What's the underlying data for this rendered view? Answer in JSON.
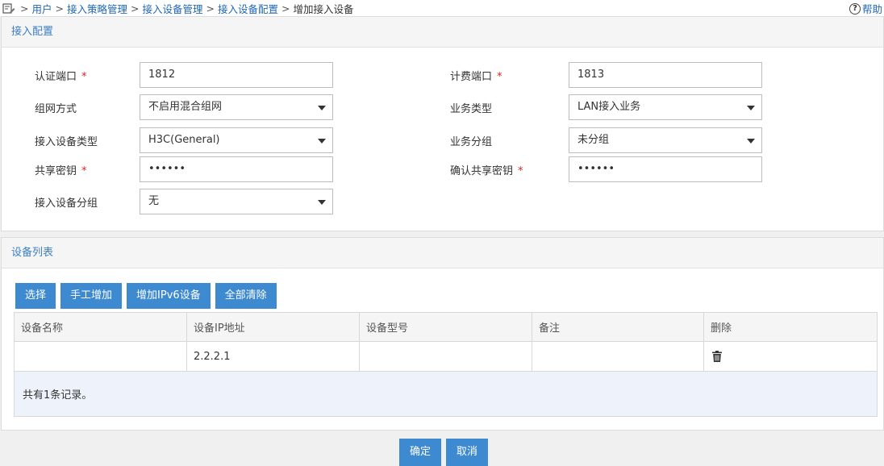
{
  "breadcrumb": {
    "items": [
      "用户",
      "接入策略管理",
      "接入设备管理",
      "接入设备配置"
    ],
    "separator": ">",
    "current": "增加接入设备"
  },
  "help": {
    "label": "帮助",
    "icon": "help-icon"
  },
  "config": {
    "title": "接入配置",
    "auth_port": {
      "label": "认证端口",
      "value": "1812",
      "required": "*"
    },
    "acct_port": {
      "label": "计费端口",
      "value": "1813",
      "required": "*"
    },
    "network_mode": {
      "label": "组网方式",
      "value": "不启用混合组网"
    },
    "service_type": {
      "label": "业务类型",
      "value": "LAN接入业务"
    },
    "device_type": {
      "label": "接入设备类型",
      "value": "H3C(General)"
    },
    "service_group": {
      "label": "业务分组",
      "value": "未分组"
    },
    "shared_key": {
      "label": "共享密钥",
      "value": "••••••",
      "required": "*"
    },
    "confirm_key": {
      "label": "确认共享密钥",
      "value": "••••••",
      "required": "*"
    },
    "device_group": {
      "label": "接入设备分组",
      "value": "无"
    }
  },
  "devices": {
    "title": "设备列表",
    "buttons": {
      "select": "选择",
      "manual_add": "手工增加",
      "add_ipv6": "增加IPv6设备",
      "clear_all": "全部清除"
    },
    "columns": [
      "设备名称",
      "设备IP地址",
      "设备型号",
      "备注",
      "删除"
    ],
    "rows": [
      {
        "name": "",
        "ip": "2.2.2.1",
        "model": "",
        "remark": ""
      }
    ],
    "footer": "共有1条记录。"
  },
  "actions": {
    "confirm": "确定",
    "cancel": "取消"
  },
  "colors": {
    "accent": "#3d8ad0",
    "link": "#1f67b6",
    "required": "#dd2222"
  }
}
